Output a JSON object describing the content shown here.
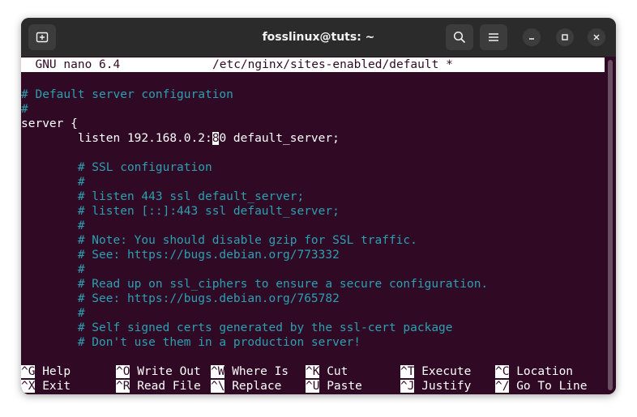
{
  "window": {
    "title": "fosslinux@tuts: ~"
  },
  "icons": {
    "new_tab": "new-tab-icon",
    "search": "search-icon",
    "menu": "hamburger-menu-icon",
    "minimize": "minimize-icon",
    "maximize": "maximize-icon",
    "close": "close-icon"
  },
  "nano": {
    "version": "  GNU nano 6.4",
    "file": "/etc/nginx/sites-enabled/default *"
  },
  "code": {
    "l1": "# Default server configuration",
    "l2": "#",
    "l3": "server {",
    "l4_pre": "        listen 192.168.0.2:",
    "l4_cursor": "8",
    "l4_post": "0 default_server;",
    "l6": "        # SSL configuration",
    "l7": "        #",
    "l8": "        # listen 443 ssl default_server;",
    "l9": "        # listen [::]:443 ssl default_server;",
    "l10": "        #",
    "l11": "        # Note: You should disable gzip for SSL traffic.",
    "l12": "        # See: https://bugs.debian.org/773332",
    "l13": "        #",
    "l14": "        # Read up on ssl_ciphers to ensure a secure configuration.",
    "l15": "        # See: https://bugs.debian.org/765782",
    "l16": "        #",
    "l17": "        # Self signed certs generated by the ssl-cert package",
    "l18": "        # Don't use them in a production server!"
  },
  "shortcuts": [
    {
      "key": "^G",
      "label": " Help"
    },
    {
      "key": "^O",
      "label": " Write Out"
    },
    {
      "key": "^W",
      "label": " Where Is"
    },
    {
      "key": "^K",
      "label": " Cut"
    },
    {
      "key": "^T",
      "label": " Execute"
    },
    {
      "key": "^C",
      "label": " Location"
    },
    {
      "key": "^X",
      "label": " Exit"
    },
    {
      "key": "^R",
      "label": " Read File"
    },
    {
      "key": "^\\",
      "label": " Replace"
    },
    {
      "key": "^U",
      "label": " Paste"
    },
    {
      "key": "^J",
      "label": " Justify"
    },
    {
      "key": "^/",
      "label": " Go To Line"
    }
  ],
  "colors": {
    "terminal_bg": "#300a24",
    "comment": "#2aa1b3",
    "titlebar": "#2b2b2b"
  }
}
